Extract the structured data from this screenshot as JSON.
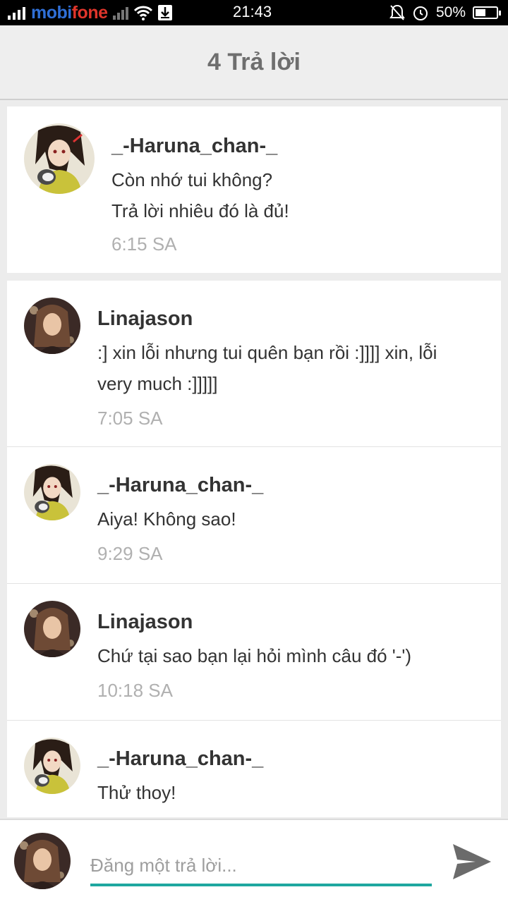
{
  "status_bar": {
    "carrier_part1": "mobi",
    "carrier_part2": "fone",
    "time": "21:43",
    "battery": "50%",
    "battery_level": 0.5
  },
  "header": {
    "title": "4 Trả lời"
  },
  "original": {
    "author": "_-Haruna_chan-_",
    "lines": [
      "Còn nhớ tui không?",
      "Trả lời nhiêu đó là đủ!"
    ],
    "time": "6:15 SA"
  },
  "replies": [
    {
      "author": "Linajason",
      "lines": [
        ":] xin lỗi nhưng tui quên bạn rồi :]]]] xin, lỗi",
        "very much :]]]]]"
      ],
      "time": "7:05 SA"
    },
    {
      "author": "_-Haruna_chan-_",
      "lines": [
        "Aiya! Không sao!"
      ],
      "time": "9:29 SA"
    },
    {
      "author": "Linajason",
      "lines": [
        "Chứ tại sao bạn lại hỏi mình câu đó '-')"
      ],
      "time": "10:18 SA"
    },
    {
      "author": "_-Haruna_chan-_",
      "lines": [
        "Thử thoy!"
      ],
      "time": ""
    }
  ],
  "reply_bar": {
    "placeholder": "Đăng một trả lời..."
  },
  "colors": {
    "accent": "#1fa7a0",
    "carrier_blue": "#2f6fd6",
    "carrier_red": "#e0352b"
  }
}
